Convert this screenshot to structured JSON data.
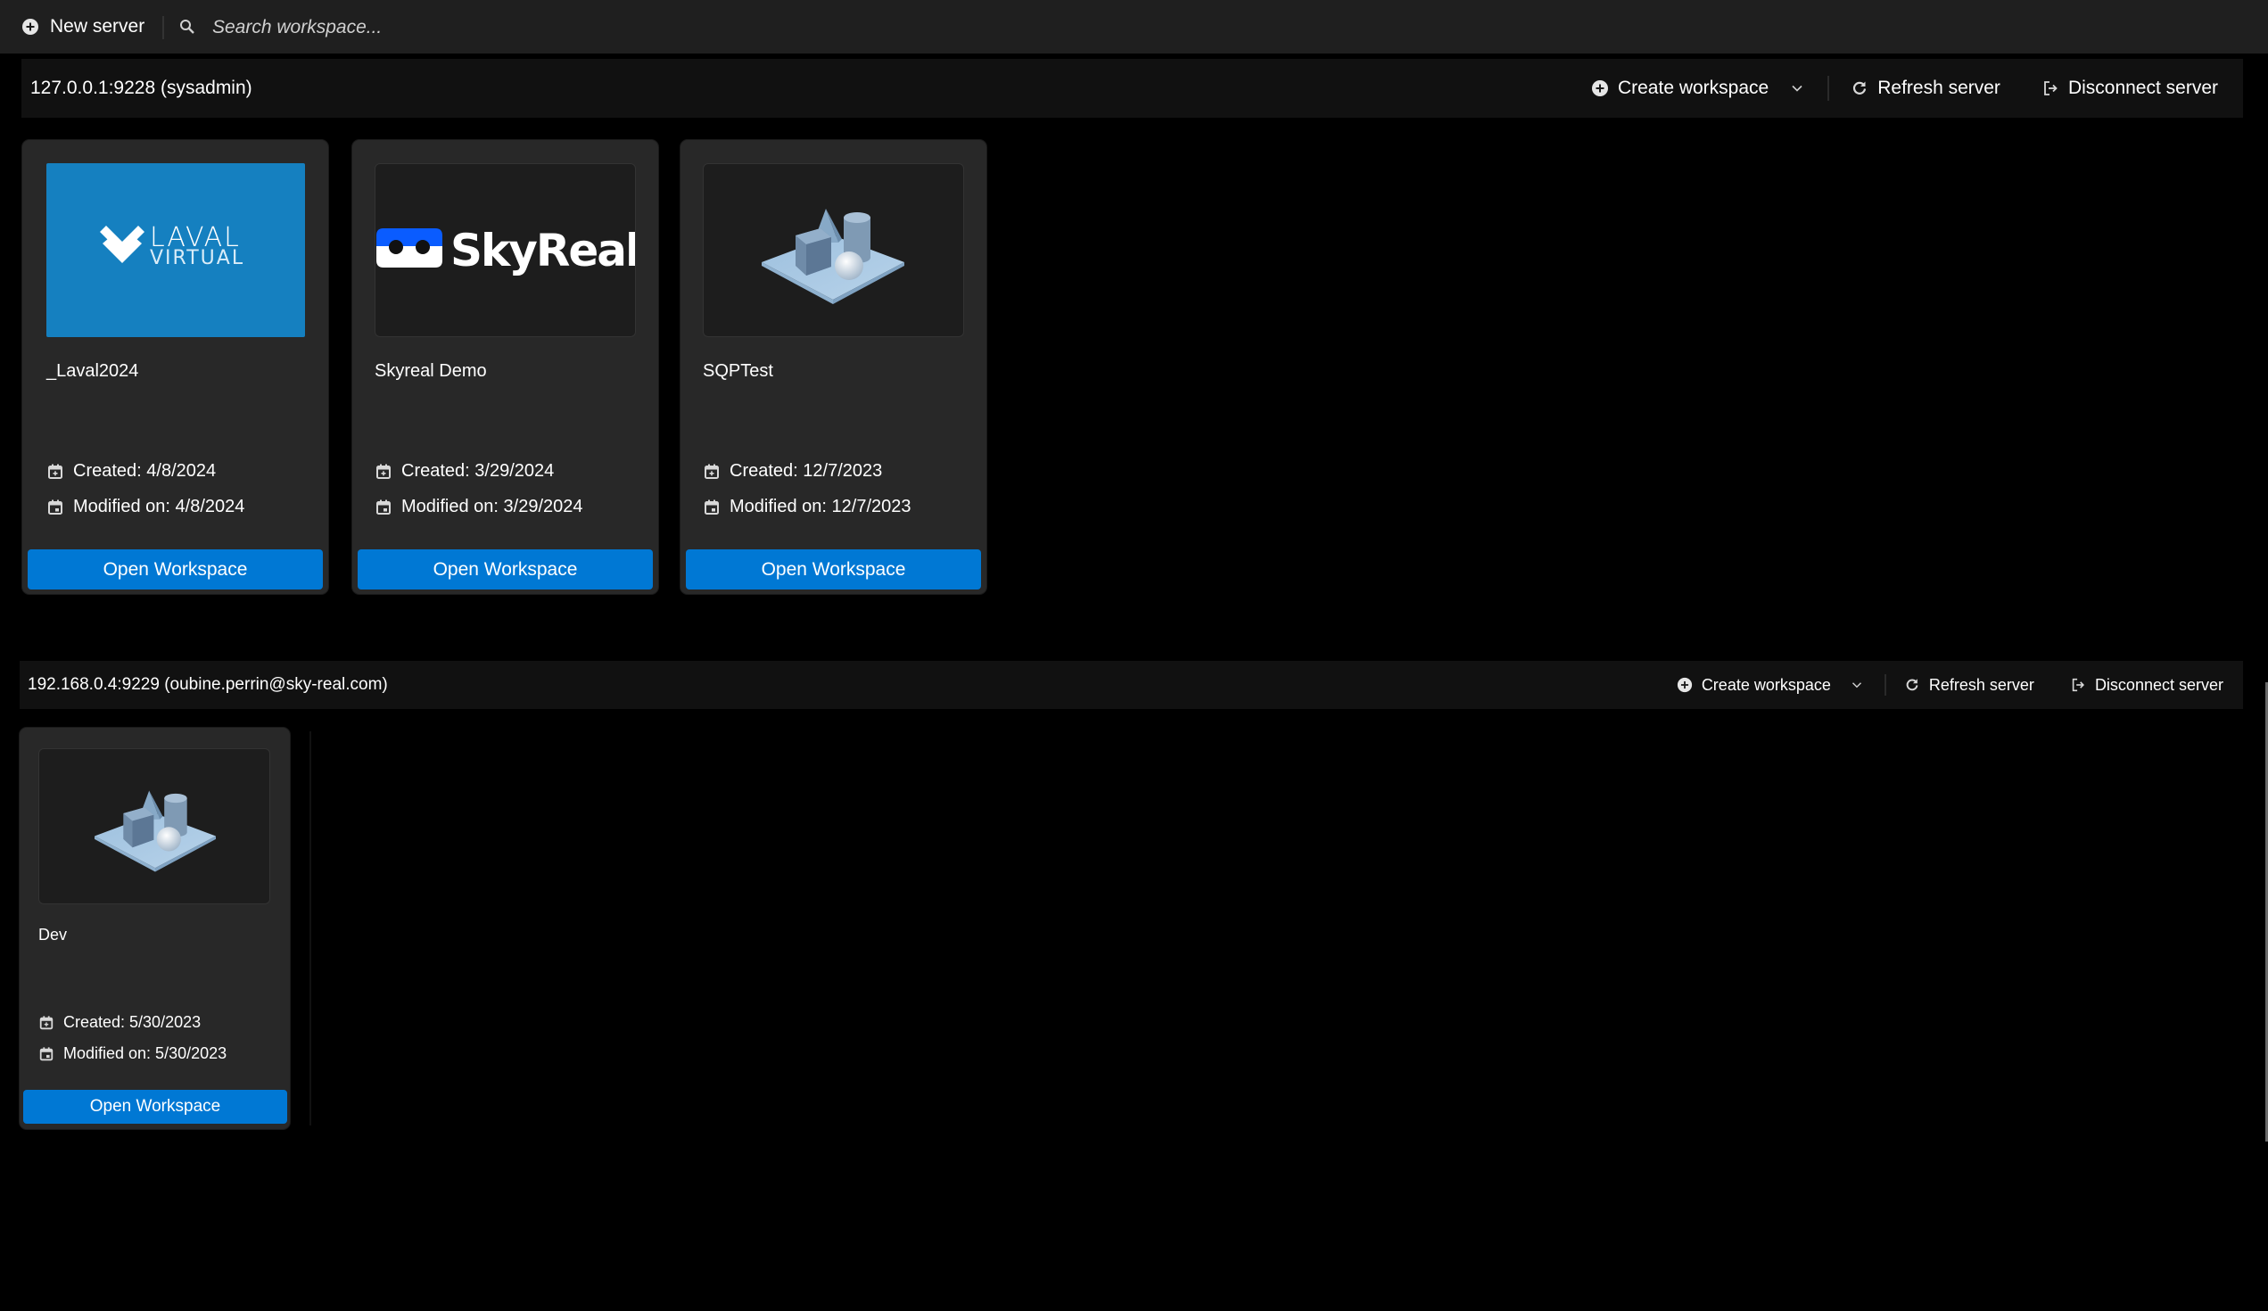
{
  "toolbar": {
    "new_server_label": "New server",
    "search_placeholder": "Search workspace..."
  },
  "colors": {
    "accent": "#0078d4",
    "header_bg": "#1f1f1f",
    "server_bar_bg": "#111111",
    "card_bg": "#282828",
    "laval_blue": "#1580c0",
    "skyreal_blue": "#0a5cff"
  },
  "servers": [
    {
      "title": "127.0.0.1:9228 (sysadmin)",
      "actions": {
        "create_label": "Create workspace",
        "refresh_label": "Refresh server",
        "disconnect_label": "Disconnect server"
      },
      "workspaces": [
        {
          "name": "_Laval2024",
          "thumbnail": "laval-virtual-logo",
          "logo_line1": "LAVAL",
          "logo_line2": "VIRTUAL",
          "created": "Created: 4/8/2024",
          "modified": "Modified on: 4/8/2024",
          "open_label": "Open Workspace"
        },
        {
          "name": "Skyreal Demo",
          "thumbnail": "skyreal-logo",
          "logo_text": "SkyReal",
          "created": "Created: 3/29/2024",
          "modified": "Modified on: 3/29/2024",
          "open_label": "Open Workspace"
        },
        {
          "name": "SQPTest",
          "thumbnail": "3d-shapes-scene",
          "created": "Created: 12/7/2023",
          "modified": "Modified on: 12/7/2023",
          "open_label": "Open Workspace"
        }
      ]
    },
    {
      "title": "192.168.0.4:9229 (oubine.perrin@sky-real.com)",
      "actions": {
        "create_label": "Create workspace",
        "refresh_label": "Refresh server",
        "disconnect_label": "Disconnect server"
      },
      "workspaces": [
        {
          "name": "Dev",
          "thumbnail": "3d-shapes-scene",
          "created": "Created: 5/30/2023",
          "modified": "Modified on: 5/30/2023",
          "open_label": "Open Workspace"
        }
      ]
    }
  ]
}
